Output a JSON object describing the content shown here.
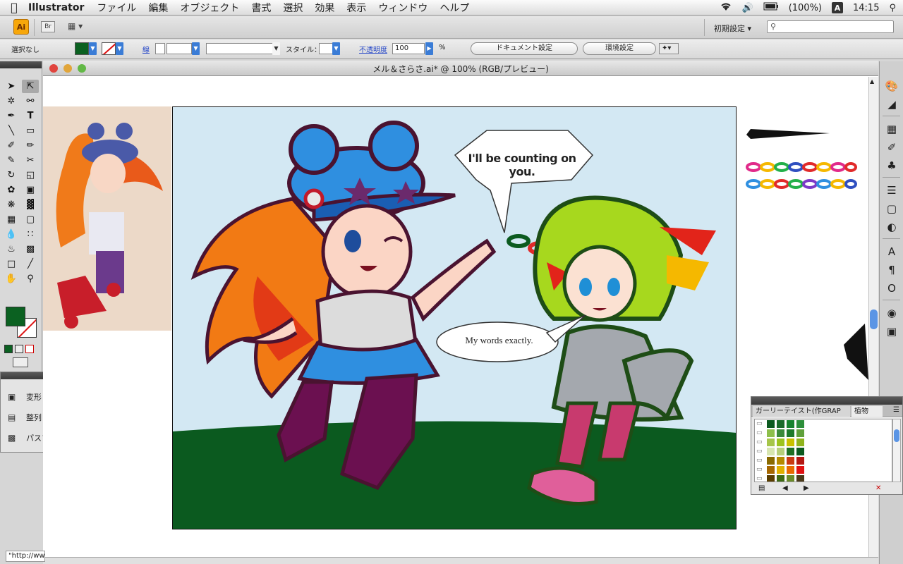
{
  "menubar": {
    "app_name": "Illustrator",
    "menus": [
      "ファイル",
      "編集",
      "オブジェクト",
      "書式",
      "選択",
      "効果",
      "表示",
      "ウィンドウ",
      "ヘルプ"
    ],
    "battery": "(100%)",
    "input_badge": "A",
    "clock": "14:15"
  },
  "appbar": {
    "logo": "Ai",
    "bridge_label": "Br",
    "workspace": "初期設定 ▾"
  },
  "control_bar": {
    "selection_label": "選択なし",
    "fill_color": "#0b6121",
    "stroke_label": "線",
    "style_label": "スタイル：",
    "opacity_label": "不透明度",
    "opacity_value": "100",
    "opacity_unit": "%",
    "doc_settings_button": "ドキュメント設定",
    "prefs_button": "環境設定"
  },
  "document": {
    "title": "メル＆さらさ.ai* @ 100% (RGB/プレビュー)",
    "bubble1": "I'll be counting on you.",
    "bubble2": "My words exactly.",
    "sky_color": "#d3e8f3",
    "grass_color": "#0b5a1f",
    "status_url": "\"http://ww"
  },
  "mini_panel": {
    "items": [
      "変形",
      "整列",
      "パスファインダ"
    ]
  },
  "swatch_panel": {
    "tab1": "ガーリーテイスト(作GRAP",
    "tab2": "植物",
    "rows": [
      [
        "#0b5a1f",
        "#1a6b2a",
        "#17832d",
        "#2c8f3a"
      ],
      [
        "#8dbf4b",
        "#3b8a3a",
        "#1e7a2b",
        "#5fa03a"
      ],
      [
        "#a6c64a",
        "#9cc31f",
        "#c8c000",
        "#8fb31c"
      ],
      [
        "#d7e6b0",
        "#b6cf7a",
        "#1e6f23",
        "#0b5a1f"
      ],
      [
        "#8a6a00",
        "#b58a00",
        "#c93a12",
        "#b31812"
      ],
      [
        "#a66700",
        "#e0b000",
        "#e86a00",
        "#e01212"
      ],
      [
        "#5a3d00",
        "#3f6b14",
        "#6b8b2a",
        "#4b3a1a"
      ]
    ]
  }
}
